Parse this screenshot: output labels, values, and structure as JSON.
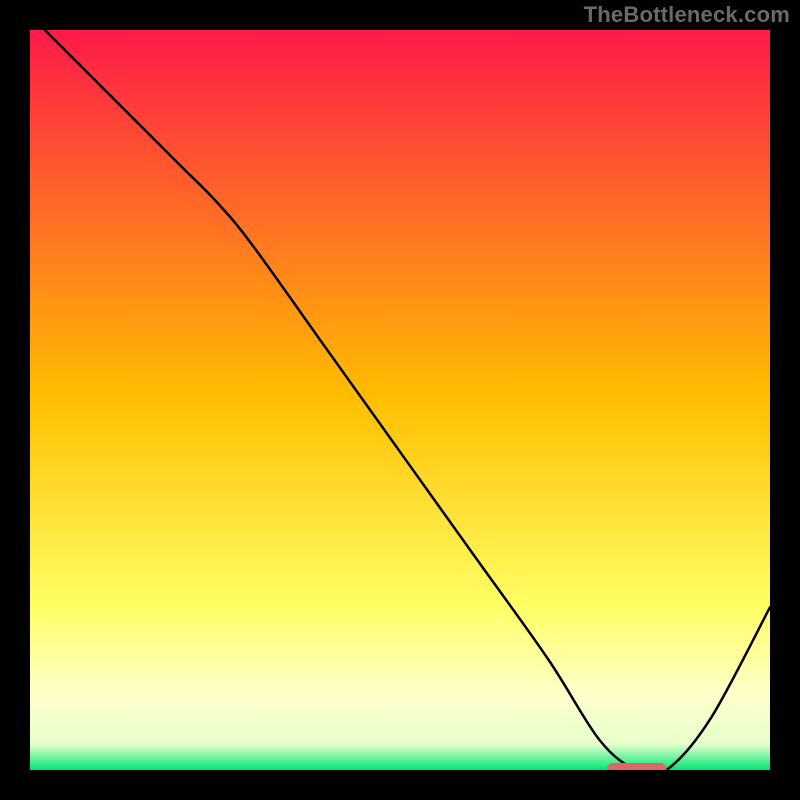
{
  "attribution": "TheBottleneck.com",
  "chart_data": {
    "type": "line",
    "title": "",
    "xlabel": "",
    "ylabel": "",
    "xlim": [
      0,
      100
    ],
    "ylim": [
      0,
      100
    ],
    "gradient_stops": [
      {
        "offset": 0.0,
        "color": "#ff1a4a"
      },
      {
        "offset": 0.5,
        "color": "#ffbf00"
      },
      {
        "offset": 0.78,
        "color": "#ffff66"
      },
      {
        "offset": 0.9,
        "color": "#ffffcc"
      },
      {
        "offset": 0.965,
        "color": "#e6ffcc"
      },
      {
        "offset": 1.0,
        "color": "#00e673"
      }
    ],
    "series": [
      {
        "name": "bottleneck-curve",
        "x": [
          2,
          10,
          20,
          25,
          30,
          40,
          50,
          60,
          70,
          77,
          82,
          86,
          92,
          100
        ],
        "y": [
          100,
          92,
          82,
          77,
          71,
          57,
          43,
          29,
          15,
          4,
          0,
          0,
          7,
          22
        ]
      }
    ],
    "marker": {
      "x_start": 78,
      "x_end": 86,
      "y": 0,
      "color": "#e06666"
    }
  }
}
